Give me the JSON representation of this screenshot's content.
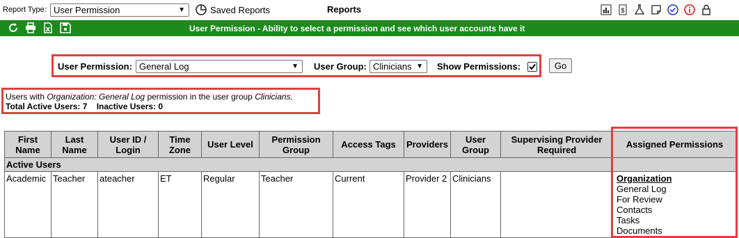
{
  "toolbar": {
    "report_type_label": "Report Type:",
    "report_type_value": "User Permission",
    "saved_reports_label": "Saved Reports",
    "reports_title": "Reports",
    "icons": [
      "chart-icon",
      "receipt-icon",
      "flask-icon",
      "note-icon",
      "check-circle-icon",
      "info-icon",
      "lock-icon"
    ]
  },
  "header_bar": {
    "title": "User Permission - Ability to select a permission and see which user accounts have it",
    "icons": [
      "refresh-icon",
      "print-icon",
      "excel-icon",
      "save-icon"
    ],
    "color": "#1c8a1c"
  },
  "filters": {
    "user_permission_label": "User Permission:",
    "user_permission_value": "General Log",
    "user_group_label": "User Group:",
    "user_group_value": "Clinicians",
    "show_permissions_label": "Show Permissions:",
    "show_permissions_checked": true,
    "go_label": "Go"
  },
  "summary": {
    "line1_prefix": "Users with ",
    "line1_permission": "Organization: General Log",
    "line1_middle": " permission in the user group ",
    "line1_group": "Clinicians.",
    "total_active_label": "Total Active Users: 7",
    "inactive_label": "Inactive Users: 0"
  },
  "table": {
    "columns": [
      "First Name",
      "Last Name",
      "User ID / Login",
      "Time Zone",
      "User Level",
      "Permission Group",
      "Access Tags",
      "Providers",
      "User Group",
      "Supervising Provider Required",
      "Assigned Permissions"
    ],
    "group_label": "Active Users",
    "rows": [
      {
        "first_name": "Academic",
        "last_name": "Teacher",
        "user_id": "ateacher",
        "time_zone": "ET",
        "user_level": "Regular",
        "permission_group": "Teacher",
        "access_tags": "Current",
        "providers": "Provider 2",
        "user_group": "Clinicians",
        "supervising": "",
        "permissions_heading": "Organization",
        "permissions": [
          "General Log",
          "For Review",
          "Contacts",
          "Tasks",
          "Documents"
        ]
      }
    ]
  },
  "highlight_color": "#e04040"
}
